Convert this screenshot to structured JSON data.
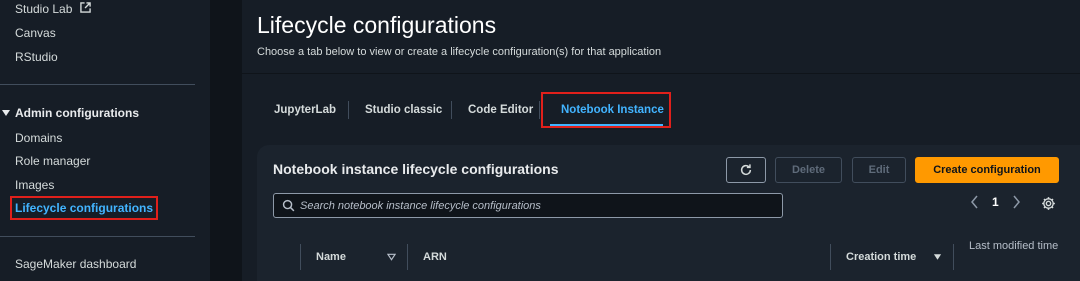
{
  "sidebar": {
    "top_items": [
      {
        "label": "Studio Lab",
        "external": true
      },
      {
        "label": "Canvas"
      },
      {
        "label": "RStudio"
      }
    ],
    "admin_section": {
      "label": "Admin configurations",
      "items": [
        {
          "label": "Domains"
        },
        {
          "label": "Role manager"
        },
        {
          "label": "Images"
        },
        {
          "label": "Lifecycle configurations",
          "active": true
        }
      ]
    },
    "bottom_items": [
      {
        "label": "SageMaker dashboard"
      }
    ]
  },
  "main": {
    "title": "Lifecycle configurations",
    "description": "Choose a tab below to view or create a lifecycle configuration(s) for that application",
    "tabs": [
      {
        "label": "JupyterLab"
      },
      {
        "label": "Studio classic"
      },
      {
        "label": "Code Editor"
      },
      {
        "label": "Notebook Instance",
        "active": true
      }
    ],
    "panel": {
      "title": "Notebook instance lifecycle configurations",
      "buttons": {
        "refresh_icon": "refresh-icon",
        "delete": "Delete",
        "edit": "Edit",
        "create": "Create configuration"
      },
      "search": {
        "placeholder": "Search notebook instance lifecycle configurations",
        "value": ""
      },
      "pagination": {
        "current_page": "1"
      },
      "table": {
        "columns": [
          "Name",
          "ARN",
          "Creation time",
          "Last modified time"
        ]
      }
    }
  },
  "colors": {
    "accent": "#42b4ff",
    "primary_button": "#ff9900",
    "highlight_box": "#e0201b",
    "background": "#161d26"
  }
}
